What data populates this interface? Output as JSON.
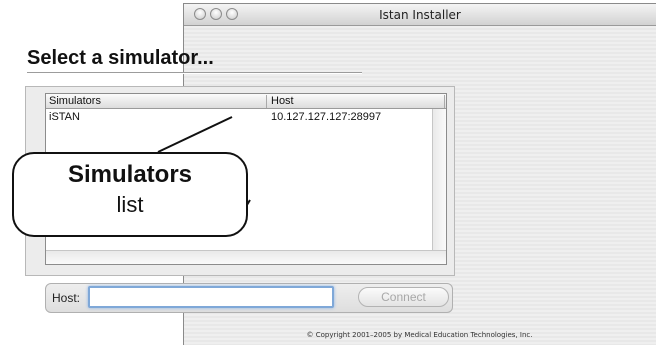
{
  "window": {
    "title": "Istan Installer"
  },
  "page": {
    "heading": "Select a simulator..."
  },
  "simulators_table": {
    "columns": [
      "Simulators",
      "Host"
    ],
    "rows": [
      {
        "name": "iSTAN",
        "host": "10.127.127.127:28997"
      }
    ]
  },
  "host_field": {
    "label": "Host:",
    "value": ""
  },
  "connect_button": {
    "label": "Connect"
  },
  "footer": {
    "copyright": "© Copyright 2001–2005 by Medical Education Technologies, Inc."
  },
  "callout": {
    "title": "Simulators",
    "subtitle": "list"
  }
}
